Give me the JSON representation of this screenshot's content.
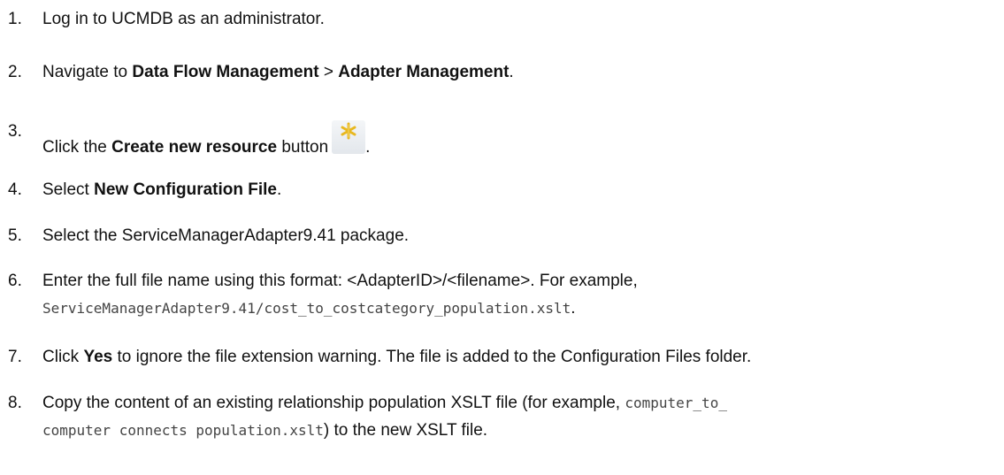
{
  "steps": [
    {
      "num": "1.",
      "text": "Log in to UCMDB as an administrator."
    },
    {
      "num": "2.",
      "pre": "Navigate to ",
      "b1": "Data Flow Management",
      "mid": " > ",
      "b2": "Adapter Management",
      "post": "."
    },
    {
      "num": "3.",
      "pre": "Click the ",
      "b1": "Create new resource",
      "post": " button",
      "tail": "."
    },
    {
      "num": "4.",
      "pre": "Select ",
      "b1": "New Configuration File",
      "post": "."
    },
    {
      "num": "5.",
      "text": "Select the ServiceManagerAdapter9.41 package."
    },
    {
      "num": "6.",
      "text": "Enter the full file name using this format: <AdapterID>/<filename>. For example,",
      "code": "ServiceManagerAdapter9.41/cost_to_costcategory_population.xslt",
      "code_post": "."
    },
    {
      "num": "7.",
      "pre": "Click ",
      "b1": "Yes",
      "post": " to ignore the file extension warning. The file is added to the Configuration Files folder."
    },
    {
      "num": "8.",
      "text": "Copy the content of an existing relationship population XSLT file (for example, ",
      "code": "computer_to_",
      "code2": "computer connects population.xslt",
      "post": ") to the new XSLT file."
    }
  ],
  "icons": {
    "create_new_resource": "asterisk-icon",
    "color": "#e8b820"
  }
}
